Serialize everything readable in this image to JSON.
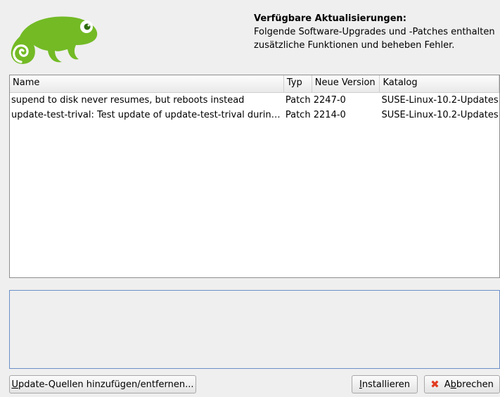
{
  "header": {
    "title": "Verfügbare Aktualisierungen:",
    "description_line1": "Folgende Software-Upgrades und -Patches enthalten",
    "description_line2": "zusätzliche Funktionen und beheben Fehler."
  },
  "logo": {
    "icon": "chameleon-logo-icon",
    "color": "#73ba25"
  },
  "table": {
    "columns": {
      "name": "Name",
      "typ": "Typ",
      "version": "Neue Version",
      "katalog": "Katalog"
    },
    "rows": [
      {
        "name": "supend to disk never resumes, but reboots instead",
        "typ": "Patch",
        "version": "2247-0",
        "katalog": "SUSE-Linux-10.2-Updates"
      },
      {
        "name": "update-test-trival: Test update of update-test-trival during ope...",
        "typ": "Patch",
        "version": "2214-0",
        "katalog": "SUSE-Linux-10.2-Updates"
      }
    ]
  },
  "buttons": {
    "sources": {
      "mnemonic": "U",
      "rest": "pdate-Quellen hinzufügen/entfernen..."
    },
    "install": {
      "mnemonic": "I",
      "rest": "nstallieren"
    },
    "cancel": {
      "pre": "A",
      "mnemonic": "b",
      "rest": "brechen",
      "icon": "cancel-x-icon"
    }
  },
  "colors": {
    "accent_border": "#6a8fc7",
    "cancel_icon": "#e23b20"
  }
}
